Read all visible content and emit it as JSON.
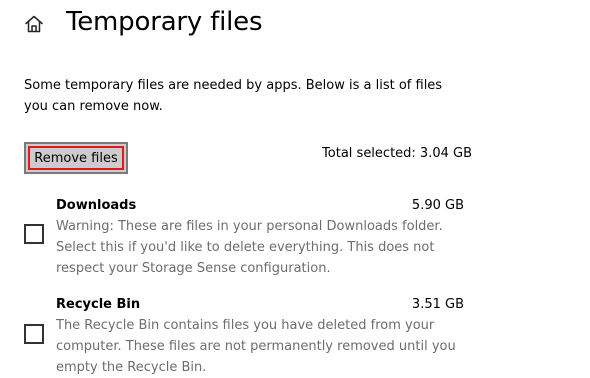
{
  "header": {
    "home_icon": "home-icon",
    "title": "Temporary files"
  },
  "description": "Some temporary files are needed by apps. Below is a list of files you can remove now.",
  "remove_button": {
    "label": "Remove files"
  },
  "total_selected": "Total selected: 3.04 GB",
  "items": [
    {
      "name": "Downloads",
      "size": "5.90 GB",
      "checked": false,
      "description": "Warning: These are files in your personal Downloads folder. Select this if you'd like to delete everything. This does not respect your Storage Sense configuration."
    },
    {
      "name": "Recycle Bin",
      "size": "3.51 GB",
      "checked": false,
      "description": "The Recycle Bin contains files you have deleted from your computer. These files are not permanently removed until you empty the Recycle Bin."
    }
  ],
  "colors": {
    "focus_outline": "#e01a1a",
    "button_bg": "#cccccc",
    "secondary_text": "#6d6d6d"
  }
}
